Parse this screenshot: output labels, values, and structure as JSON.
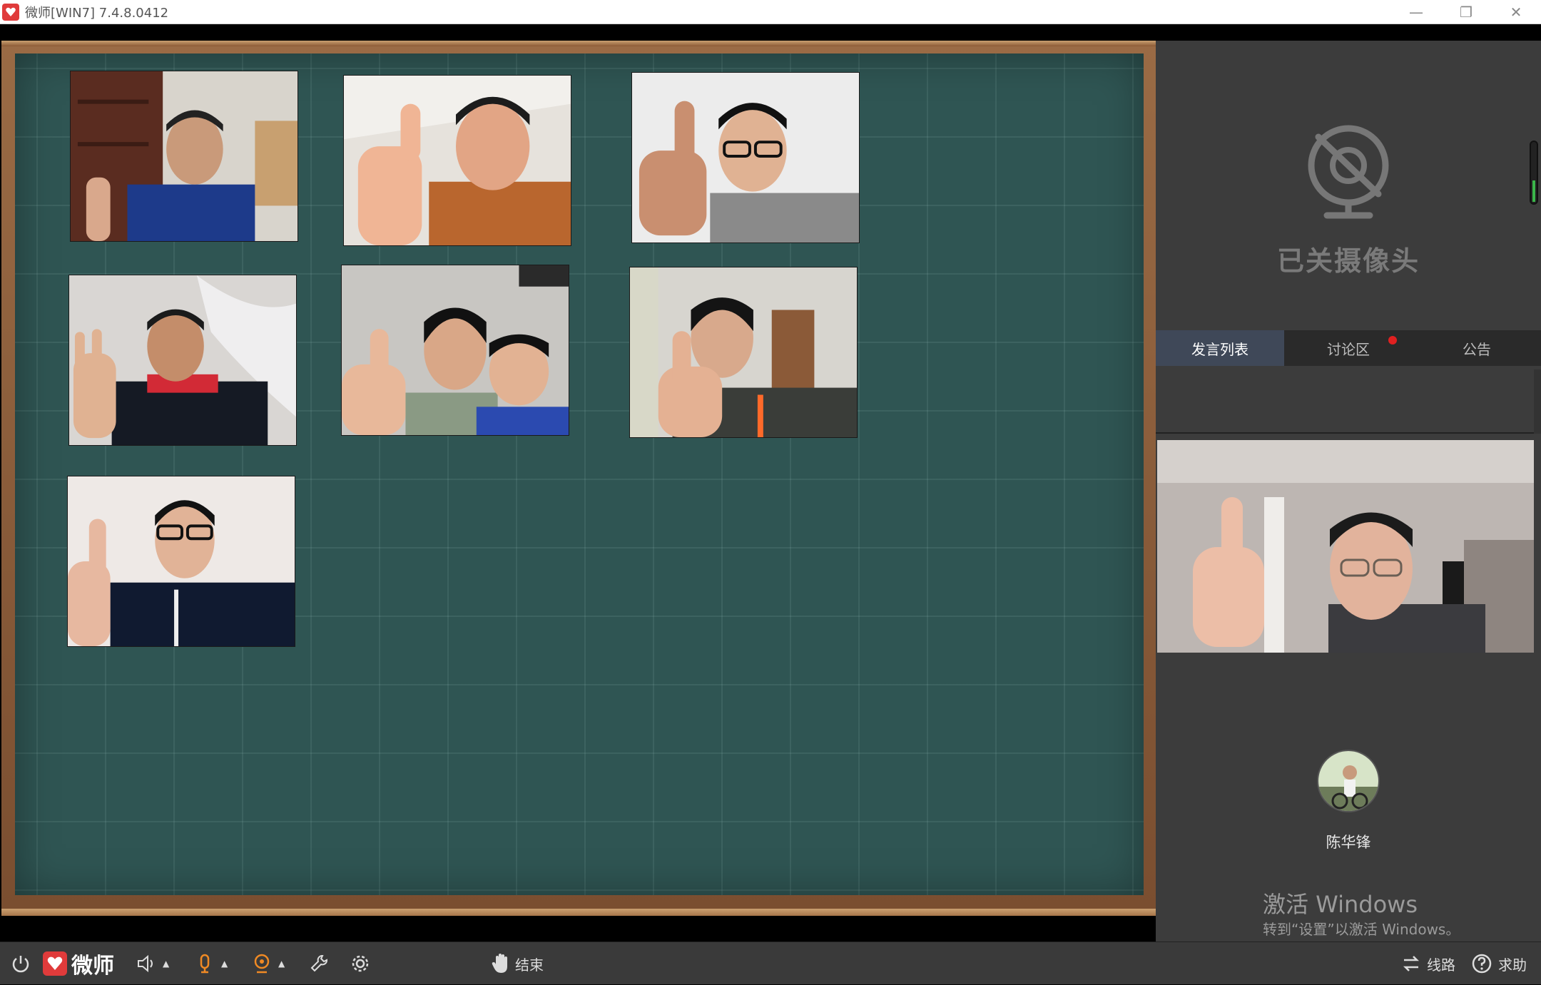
{
  "window": {
    "title": "微师[WIN7] 7.4.8.0412",
    "minimize_label": "—",
    "restore_label": "❐",
    "close_label": "✕"
  },
  "right_panel": {
    "camera_off_text": "已关摄像头",
    "tabs": [
      {
        "label": "发言列表",
        "active": true
      },
      {
        "label": "讨论区",
        "active": false,
        "has_notification": true
      },
      {
        "label": "公告",
        "active": false
      }
    ],
    "teacher": {
      "name": "陈华锋"
    },
    "watermark": {
      "title": "激活 Windows",
      "subtitle": "转到“设置”以激活 Windows。"
    }
  },
  "toolbar": {
    "brand": "微师",
    "end_label": "结束",
    "route_label": "线路",
    "help_label": "求助"
  },
  "colors": {
    "board": "#2f5553",
    "frame": "#8b5a35",
    "accent": "#e03b3b",
    "mic_orange": "#f08a24",
    "active_tab": "#3f4858"
  }
}
